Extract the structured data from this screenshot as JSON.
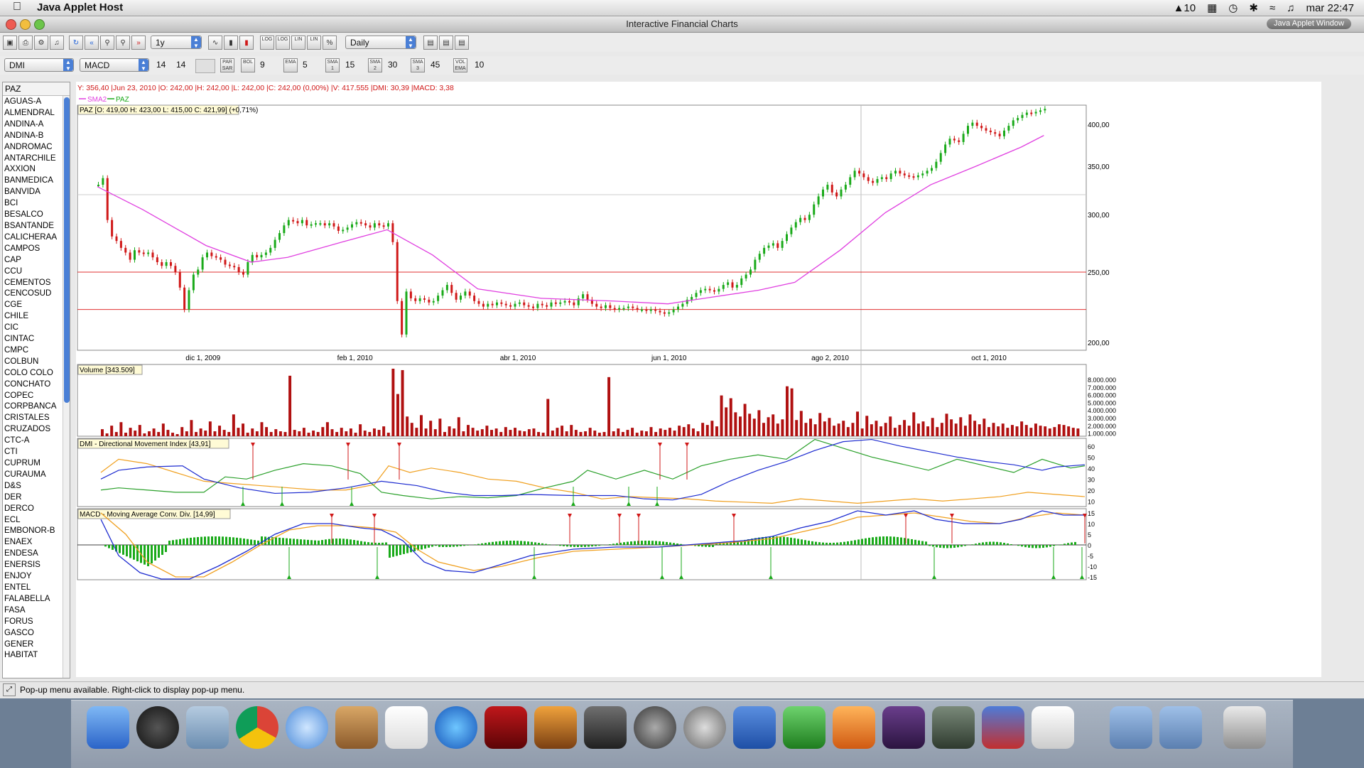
{
  "menubar": {
    "app_name": "Java Applet Host",
    "status_num": "10",
    "clock": "mar 22:47"
  },
  "window": {
    "title": "Interactive Financial Charts",
    "badge": "Java Applet Window"
  },
  "toolbar1": {
    "period": "1y",
    "interval": "Daily",
    "buttons": [
      "LOG",
      "LOG",
      "LIN",
      "LIN",
      "%"
    ]
  },
  "toolbar2": {
    "indicator1": "DMI",
    "indicator2": "MACD",
    "macd_p1": "14",
    "macd_p2": "14",
    "par_sar": "PAR SAR",
    "bol_label": "BOL",
    "bol_val": "9",
    "ema_label": "EMA",
    "ema_val": "5",
    "sma1_label": "SMA 1",
    "sma1_val": "15",
    "sma2_label": "SMA 2",
    "sma2_val": "30",
    "sma3_label": "SMA 3",
    "sma3_val": "45",
    "vol_label": "VOL EMA",
    "vol_val": "10"
  },
  "symbols": {
    "selected": "PAZ",
    "items": [
      "AGUAS-A",
      "ALMENDRAL",
      "ANDINA-A",
      "ANDINA-B",
      "ANDROMAC",
      "ANTARCHILE",
      "AXXION",
      "BANMEDICA",
      "BANVIDA",
      "BCI",
      "BESALCO",
      "BSANTANDE",
      "CALICHERAA",
      "CAMPOS",
      "CAP",
      "CCU",
      "CEMENTOS",
      "CENCOSUD",
      "CGE",
      "CHILE",
      "CIC",
      "CINTAC",
      "CMPC",
      "COLBUN",
      "COLO COLO",
      "CONCHATO",
      "COPEC",
      "CORPBANCA",
      "CRISTALES",
      "CRUZADOS",
      "CTC-A",
      "CTI",
      "CUPRUM",
      "CURAUMA",
      "D&S",
      "DER",
      "DERCO",
      "ECL",
      "EMBONOR-B",
      "ENAEX",
      "ENDESA",
      "ENERSIS",
      "ENJOY",
      "ENTEL",
      "FALABELLA",
      "FASA",
      "FORUS",
      "GASCO",
      "GENER",
      "HABITAT"
    ]
  },
  "chart": {
    "info_line": "Y: 356,40 |Jun 23, 2010 |O: 242,00 |H: 242,00 |L: 242,00 |C: 242,00 (0,00%) |V: 417.555 |DMI: 30,39 |MACD: 3,38",
    "legend_sma": "SMA2",
    "legend_paz": "PAZ",
    "price_label": "PAZ [O: 419,00  H: 423,00  L: 415,00  C: 421,99] (+0,71%)",
    "volume_label": "Volume [343.509]",
    "dmi_label": "DMI - Directional Movement Index [43,91]",
    "macd_label": "MACD - Moving Average Conv. Div. [14,99]",
    "date_labels": [
      "dic 1, 2009",
      "feb 1, 2010",
      "abr 1, 2010",
      "jun 1, 2010",
      "ago 2, 2010",
      "oct 1, 2010"
    ],
    "price_ticks": [
      "400,00",
      "350,00",
      "300,00",
      "250,00",
      "200,00"
    ],
    "volume_ticks": [
      "8.000.000",
      "7.000.000",
      "6.000.000",
      "5.000.000",
      "4.000.000",
      "3.000.000",
      "2.000.000",
      "1.000.000"
    ],
    "dmi_ticks": [
      "60",
      "50",
      "40",
      "30",
      "20",
      "10"
    ],
    "macd_ticks": [
      "15",
      "10",
      "5",
      "0",
      "-5",
      "-10",
      "-15"
    ],
    "colors": {
      "up": "#1aaa1a",
      "down": "#d01818",
      "sma": "#e040e0",
      "macd": "#1d2bd0",
      "signal": "#f0a020",
      "volume": "#b01010",
      "hline": "#e03030"
    }
  },
  "status": {
    "text": "Pop-up menu available. Right-click to display pop-up menu."
  },
  "chart_data": {
    "type": "line",
    "title": "PAZ",
    "x": [
      "dic 1, 2009",
      "feb 1, 2010",
      "abr 1, 2010",
      "jun 1, 2010",
      "ago 2, 2010",
      "oct 1, 2010"
    ],
    "series": [
      {
        "name": "PAZ",
        "values": [
          268,
          292,
          232,
          222,
          285,
          385
        ]
      },
      {
        "name": "SMA2",
        "values": [
          290,
          268,
          237,
          227,
          248,
          360
        ]
      }
    ],
    "ylim": [
      200,
      420
    ],
    "hlines": [
      250,
      222
    ]
  }
}
